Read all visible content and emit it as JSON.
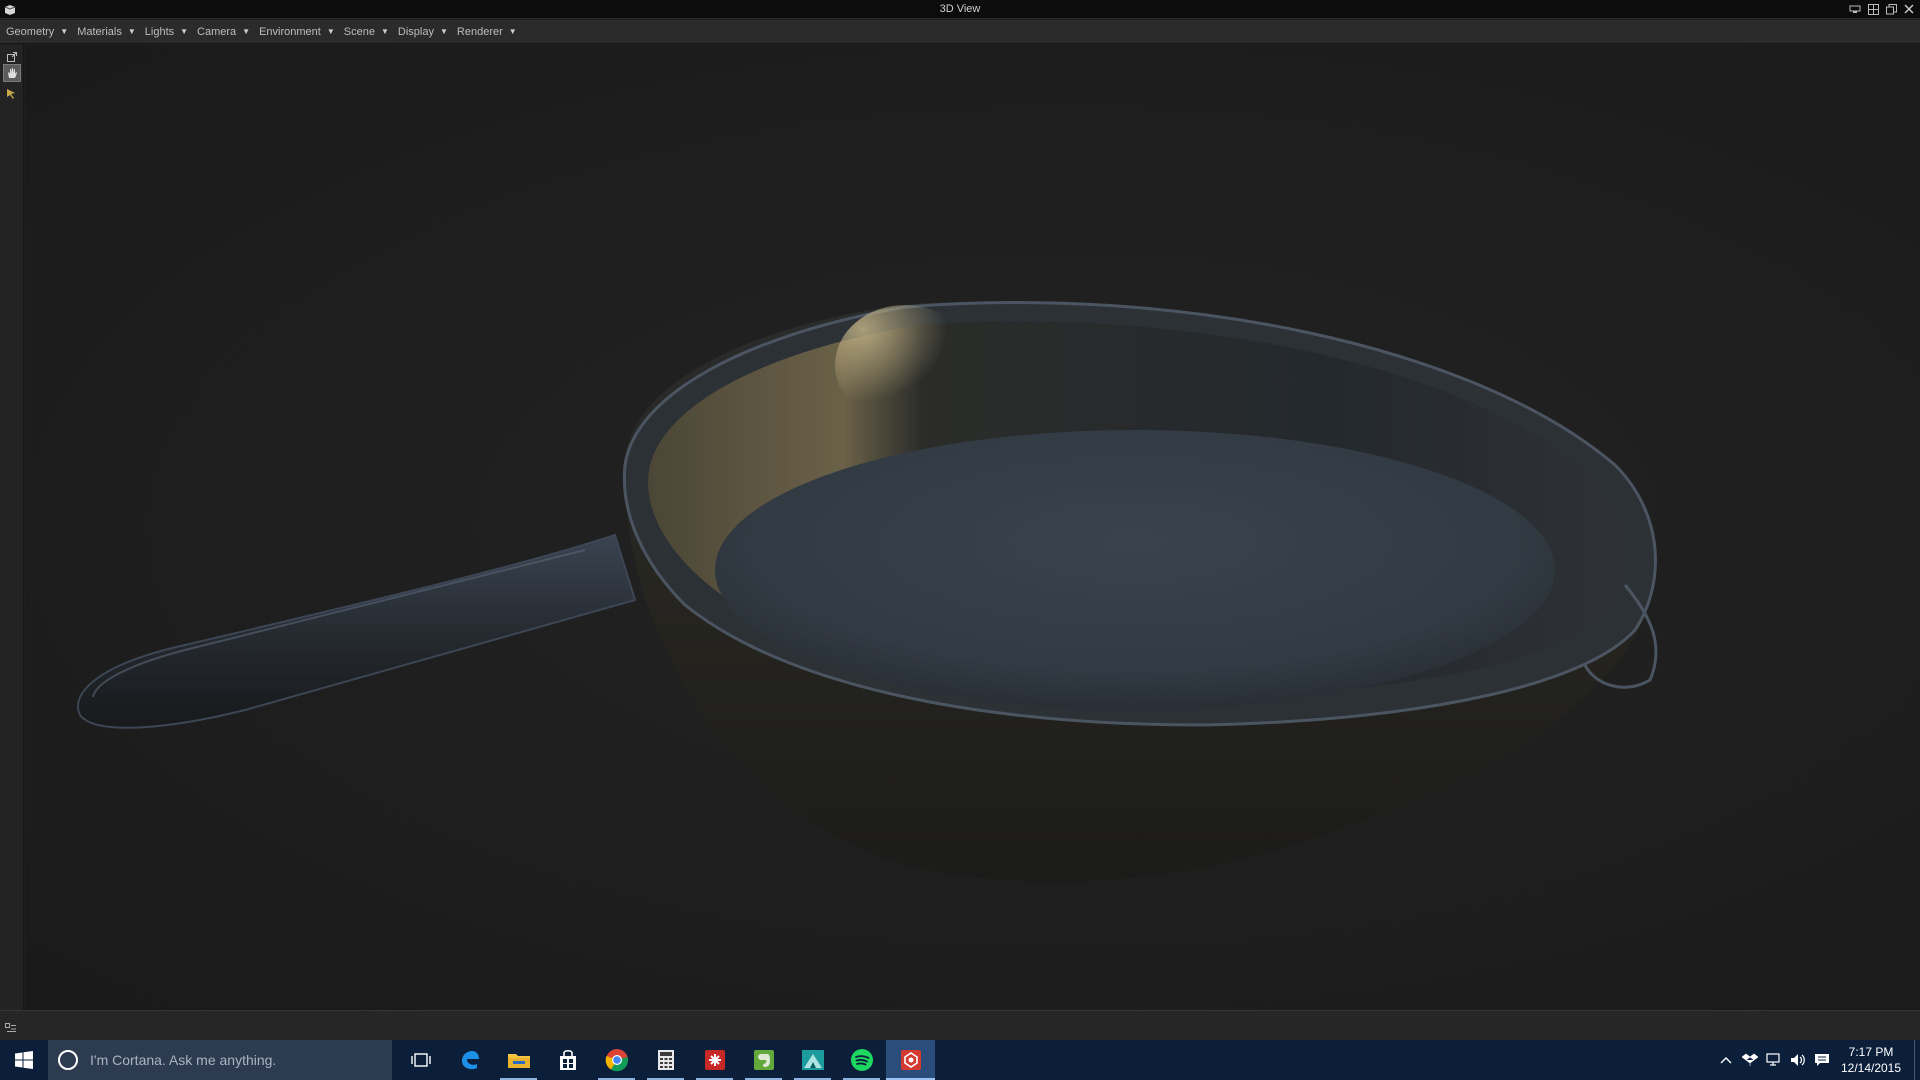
{
  "window": {
    "title": "3D View"
  },
  "menubar": {
    "items": [
      {
        "label": "Geometry"
      },
      {
        "label": "Materials"
      },
      {
        "label": "Lights"
      },
      {
        "label": "Camera"
      },
      {
        "label": "Environment"
      },
      {
        "label": "Scene"
      },
      {
        "label": "Display"
      },
      {
        "label": "Renderer"
      }
    ]
  },
  "toolbar": {
    "tools": [
      "export-icon",
      "hand-tool-icon",
      "select-arrow-icon"
    ]
  },
  "viewport": {
    "object": "cast-iron-skillet",
    "colors": {
      "background": "#1e1e1e",
      "metal": "#2a2f35",
      "highlight": "#9a8e6a"
    }
  },
  "taskbar": {
    "search_placeholder": "I'm Cortana. Ask me anything.",
    "apps": [
      "task-view-icon",
      "edge-icon",
      "file-explorer-icon",
      "store-icon",
      "chrome-icon",
      "calculator-icon",
      "red-app-icon",
      "evernote-icon",
      "maps-app-icon",
      "spotify-icon",
      "substance-painter-icon"
    ],
    "clock": {
      "time": "7:17 PM",
      "date": "12/14/2015"
    }
  }
}
